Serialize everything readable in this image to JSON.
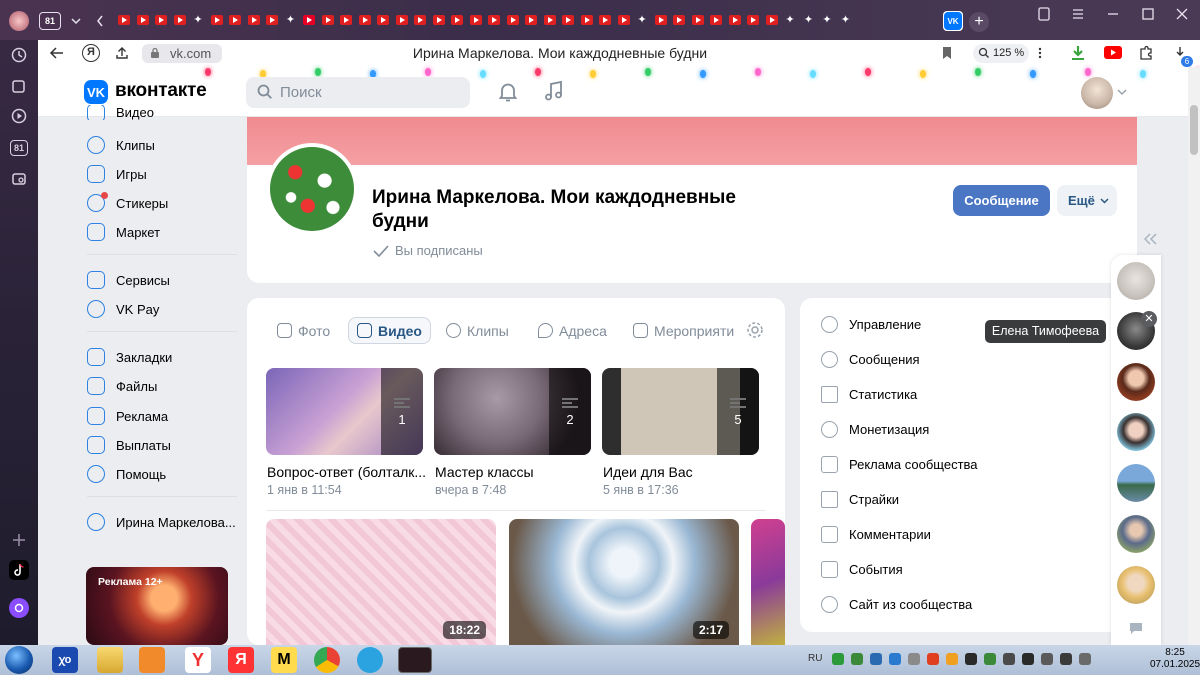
{
  "browser": {
    "tab_count_badge": "81",
    "url": "vk.com",
    "page_title": "Ирина Маркелова. Мои каждодневные будни",
    "zoom": "125 %",
    "downloads_badge": "6"
  },
  "vk_header": {
    "logo_text": "вконтакте",
    "search_placeholder": "Поиск"
  },
  "left_menu": {
    "items": [
      {
        "label": "Видео"
      },
      {
        "label": "Клипы"
      },
      {
        "label": "Игры"
      },
      {
        "label": "Стикеры"
      },
      {
        "label": "Маркет"
      },
      {
        "label": "Сервисы"
      },
      {
        "label": "VK Pay"
      },
      {
        "label": "Закладки"
      },
      {
        "label": "Файлы"
      },
      {
        "label": "Реклама"
      },
      {
        "label": "Выплаты"
      },
      {
        "label": "Помощь"
      },
      {
        "label": "Ирина Маркелова..."
      }
    ],
    "ad_label": "Реклама 12+"
  },
  "group": {
    "name": "Ирина Маркелова. Мои каждодневные будни",
    "subscribed_status": "Вы подписаны",
    "message_button": "Сообщение",
    "more_button": "Ещё"
  },
  "media_tabs": [
    {
      "label": "Фото"
    },
    {
      "label": "Видео"
    },
    {
      "label": "Клипы"
    },
    {
      "label": "Адреса"
    },
    {
      "label": "Мероприяти"
    }
  ],
  "albums": [
    {
      "title": "Вопрос-ответ (болталк...",
      "date": "1 янв в 11:54",
      "count": "1"
    },
    {
      "title": "Мастер классы",
      "date": "вчера в 7:48",
      "count": "2"
    },
    {
      "title": "Идеи для Вас",
      "date": "5 янв в 17:36",
      "count": "5"
    }
  ],
  "videos": [
    {
      "duration": "18:22"
    },
    {
      "duration": "2:17"
    }
  ],
  "admin_menu": [
    {
      "label": "Управление"
    },
    {
      "label": "Сообщения"
    },
    {
      "label": "Статистика"
    },
    {
      "label": "Монетизация"
    },
    {
      "label": "Реклама сообщества"
    },
    {
      "label": "Страйки"
    },
    {
      "label": "Комментарии"
    },
    {
      "label": "События"
    },
    {
      "label": "Сайт из сообщества"
    }
  ],
  "chat_tooltip": "Елена Тимофеева",
  "taskbar": {
    "lang": "RU",
    "time": "8:25",
    "date": "07.01.2025"
  }
}
